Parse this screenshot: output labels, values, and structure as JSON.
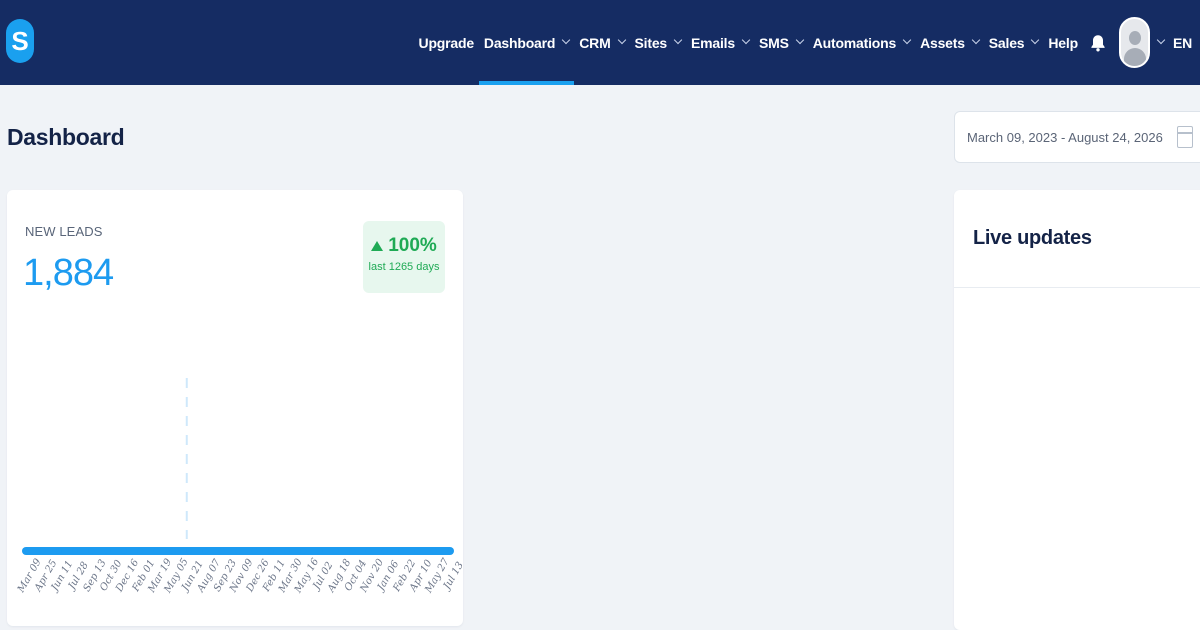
{
  "app": {
    "logo_letter": "S"
  },
  "nav": {
    "items": [
      {
        "label": "Upgrade",
        "dropdown": false,
        "active": false
      },
      {
        "label": "Dashboard",
        "dropdown": true,
        "active": true
      },
      {
        "label": "CRM",
        "dropdown": true,
        "active": false
      },
      {
        "label": "Sites",
        "dropdown": true,
        "active": false
      },
      {
        "label": "Emails",
        "dropdown": true,
        "active": false
      },
      {
        "label": "SMS",
        "dropdown": true,
        "active": false
      },
      {
        "label": "Automations",
        "dropdown": true,
        "active": false
      },
      {
        "label": "Assets",
        "dropdown": true,
        "active": false
      },
      {
        "label": "Sales",
        "dropdown": true,
        "active": false
      },
      {
        "label": "Help",
        "dropdown": false,
        "active": false
      }
    ],
    "notifications_icon": "bell-icon",
    "language": "EN"
  },
  "page": {
    "title": "Dashboard",
    "date_range": "March 09, 2023 - August 24, 2026"
  },
  "new_leads": {
    "label": "NEW LEADS",
    "value": "1,884",
    "trend_percent": "100%",
    "trend_direction": "up",
    "trend_period": "last 1265 days"
  },
  "chart_data": {
    "type": "line",
    "x": [
      "Mar 09",
      "Apr 25",
      "Jun 11",
      "Jul 28",
      "Sep 13",
      "Oct 30",
      "Dec 16",
      "Feb 01",
      "Mar 19",
      "May 05",
      "Jun 21",
      "Aug 07",
      "Sep 23",
      "Nov 09",
      "Dec 26",
      "Feb 11",
      "Mar 30",
      "May 16",
      "Jul 02",
      "Aug 18",
      "Oct 04",
      "Nov 20",
      "Jan 06",
      "Feb 22",
      "Apr 10",
      "May 27",
      "Jul 13"
    ],
    "series": [
      {
        "values": [
          0,
          0,
          0,
          0,
          0,
          0,
          0,
          0,
          0,
          0,
          0,
          0,
          0,
          0,
          0,
          0,
          0,
          0,
          0,
          0,
          0,
          0,
          0,
          0,
          0,
          0,
          0
        ]
      }
    ],
    "spike_x": "May 05",
    "colors": {
      "line": "#1d9bf0",
      "spike": "#cfe8fb"
    },
    "grid": false,
    "legend": "none"
  },
  "live_updates": {
    "title": "Live updates"
  },
  "colors": {
    "nav_bg": "#152c63",
    "accent": "#1aa0ef",
    "positive": "#1faa55",
    "page_bg": "#f0f3f7"
  }
}
